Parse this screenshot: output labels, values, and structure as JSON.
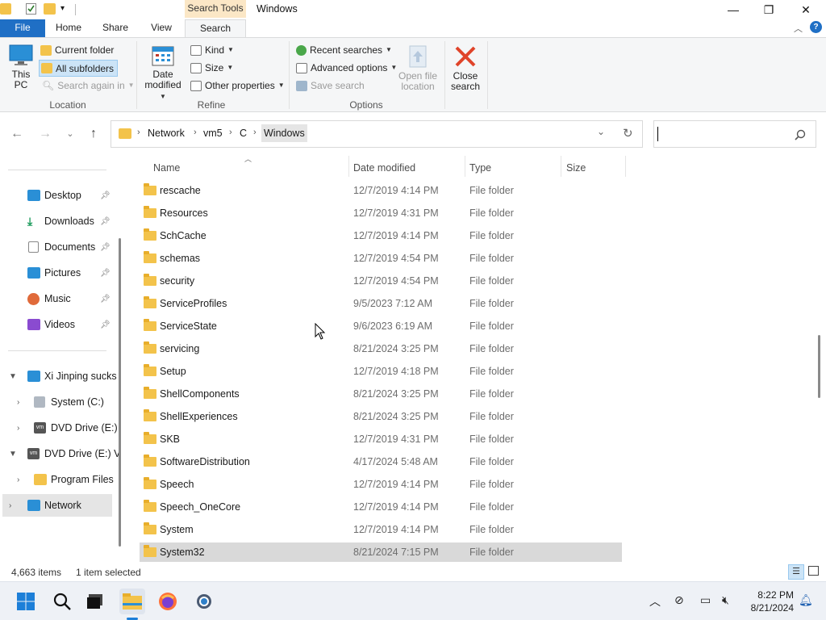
{
  "window": {
    "title": "Windows",
    "context_tab": "Search Tools",
    "minimize": "—",
    "maximize": "❐",
    "close": "✕"
  },
  "ribbon_tabs": [
    {
      "label": "File"
    },
    {
      "label": "Home"
    },
    {
      "label": "Share"
    },
    {
      "label": "View"
    },
    {
      "label": "Search"
    }
  ],
  "ribbon": {
    "location": {
      "this_pc_line1": "This",
      "this_pc_line2": "PC",
      "current_folder": "Current folder",
      "all_subfolders": "All subfolders",
      "search_again_in": "Search again in",
      "group_label": "Location"
    },
    "refine": {
      "date_modified_line1": "Date",
      "date_modified_line2": "modified",
      "kind": "Kind",
      "size": "Size",
      "other_properties": "Other properties",
      "group_label": "Refine"
    },
    "options": {
      "recent_searches": "Recent searches",
      "advanced_options": "Advanced options",
      "save_search": "Save search",
      "open_file_location_line1": "Open file",
      "open_file_location_line2": "location",
      "close_search_line1": "Close",
      "close_search_line2": "search",
      "group_label": "Options"
    }
  },
  "address": {
    "crumbs": [
      "Network",
      "vm5",
      "C",
      "Windows"
    ]
  },
  "search": {
    "placeholder": ""
  },
  "nav": {
    "quick_access": [
      {
        "label": "Desktop"
      },
      {
        "label": "Downloads"
      },
      {
        "label": "Documents"
      },
      {
        "label": "Pictures"
      },
      {
        "label": "Music"
      },
      {
        "label": "Videos"
      }
    ],
    "tree": [
      {
        "label": "Xi Jinping sucks"
      },
      {
        "label": "System (C:)"
      },
      {
        "label": "DVD Drive (E:)"
      },
      {
        "label": "DVD Drive (E:) V"
      },
      {
        "label": "Program Files"
      },
      {
        "label": "Network"
      }
    ]
  },
  "columns": {
    "name": "Name",
    "date": "Date modified",
    "type": "Type",
    "size": "Size"
  },
  "files": [
    {
      "name": "rescache",
      "date": "12/7/2019 4:14 PM",
      "type": "File folder"
    },
    {
      "name": "Resources",
      "date": "12/7/2019 4:31 PM",
      "type": "File folder"
    },
    {
      "name": "SchCache",
      "date": "12/7/2019 4:14 PM",
      "type": "File folder"
    },
    {
      "name": "schemas",
      "date": "12/7/2019 4:54 PM",
      "type": "File folder"
    },
    {
      "name": "security",
      "date": "12/7/2019 4:54 PM",
      "type": "File folder"
    },
    {
      "name": "ServiceProfiles",
      "date": "9/5/2023 7:12 AM",
      "type": "File folder"
    },
    {
      "name": "ServiceState",
      "date": "9/6/2023 6:19 AM",
      "type": "File folder"
    },
    {
      "name": "servicing",
      "date": "8/21/2024 3:25 PM",
      "type": "File folder"
    },
    {
      "name": "Setup",
      "date": "12/7/2019 4:18 PM",
      "type": "File folder"
    },
    {
      "name": "ShellComponents",
      "date": "8/21/2024 3:25 PM",
      "type": "File folder"
    },
    {
      "name": "ShellExperiences",
      "date": "8/21/2024 3:25 PM",
      "type": "File folder"
    },
    {
      "name": "SKB",
      "date": "12/7/2019 4:31 PM",
      "type": "File folder"
    },
    {
      "name": "SoftwareDistribution",
      "date": "4/17/2024 5:48 AM",
      "type": "File folder"
    },
    {
      "name": "Speech",
      "date": "12/7/2019 4:14 PM",
      "type": "File folder"
    },
    {
      "name": "Speech_OneCore",
      "date": "12/7/2019 4:14 PM",
      "type": "File folder"
    },
    {
      "name": "System",
      "date": "12/7/2019 4:14 PM",
      "type": "File folder"
    },
    {
      "name": "System32",
      "date": "8/21/2024 7:15 PM",
      "type": "File folder",
      "selected": true
    }
  ],
  "status": {
    "items": "4,663 items",
    "selected": "1 item selected"
  },
  "taskbar": {
    "time": "8:22 PM",
    "date": "8/21/2024"
  },
  "colors": {
    "accent": "#1f6fc5",
    "folder": "#f3c34b",
    "context_tab": "#fbe7c6"
  }
}
